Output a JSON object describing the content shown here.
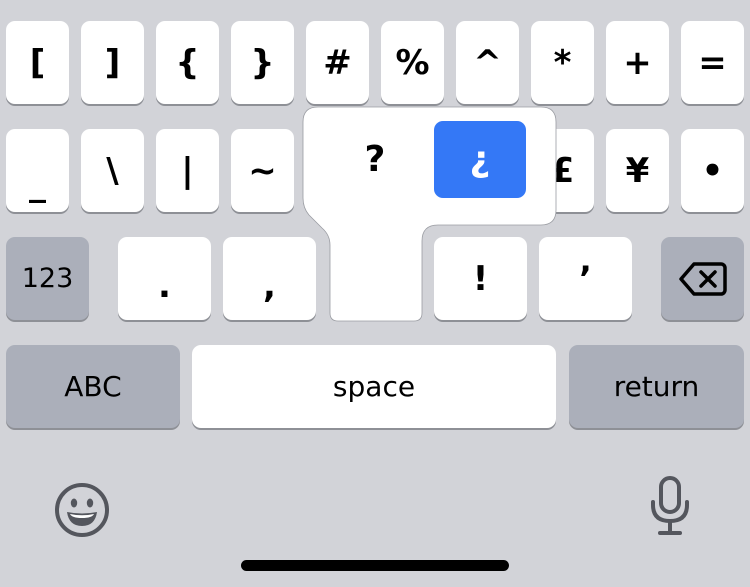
{
  "keyboard": {
    "row1": [
      "[",
      "]",
      "{",
      "}",
      "#",
      "%",
      "^",
      "*",
      "+",
      "="
    ],
    "row2": [
      "_",
      "\\",
      "|",
      "~",
      "£",
      "¥",
      "•"
    ],
    "row3": {
      "mode_label": "123",
      "keys": [
        ".",
        ",",
        "!",
        "’"
      ]
    },
    "row4": {
      "abc_label": "ABC",
      "space_label": "space",
      "return_label": "return"
    },
    "popup": {
      "options": [
        "?",
        "¿"
      ],
      "selected": "¿"
    },
    "icons": {
      "delete": "backspace-icon",
      "emoji": "emoji-icon",
      "microphone": "microphone-icon"
    },
    "colors": {
      "background": "#d2d3d8",
      "key": "#ffffff",
      "function_key": "#abafba",
      "selected": "#3478f6"
    }
  }
}
